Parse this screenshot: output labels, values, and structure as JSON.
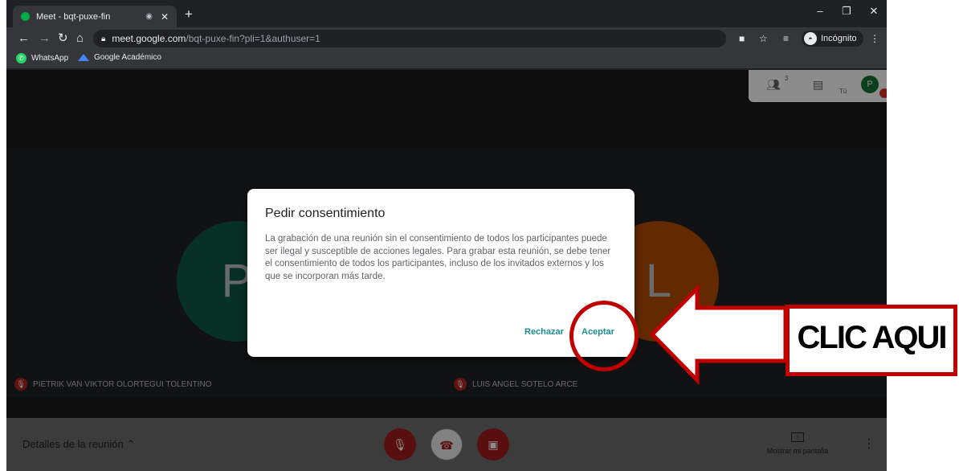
{
  "browser": {
    "tab_title": "Meet - bqt-puxe-fin",
    "url_host": "meet.google.com",
    "url_path": "/bqt-puxe-fin?pli=1&authuser=1",
    "incognito_label": "Incógnito",
    "bookmarks": [
      "WhatsApp",
      "Google Académico"
    ]
  },
  "meet": {
    "participant_count": "3",
    "self_label": "Tú",
    "self_initial": "P",
    "tile_left_initial": "P",
    "tile_right_initial": "L",
    "participant_left": "PIETRIK VAN VIKTOR OLORTEGUI TOLENTINO",
    "participant_right": "LUIS ANGEL SOTELO ARCE",
    "details_label": "Detalles de la reunión",
    "share_label": "Mostrar mi pantalla"
  },
  "dialog": {
    "title": "Pedir consentimiento",
    "body": "La grabación de una reunión sin el consentimiento de todos los participantes puede ser ilegal y susceptible de acciones legales. Para grabar esta reunión, se debe tener el consentimiento de todos los participantes, incluso de los invitados externos y los que se incorporan más tarde.",
    "reject_label": "Rechazar",
    "accept_label": "Aceptar"
  },
  "annotation": {
    "label": "CLIC AQUI",
    "color": "#c00000"
  }
}
